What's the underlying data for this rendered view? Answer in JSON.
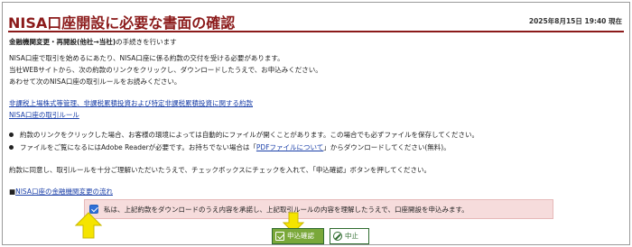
{
  "header": {
    "title": "NISA口座開設に必要な書面の確認",
    "datetime": "2025年8月15日 19:40 現在"
  },
  "intro": {
    "procedure_bold": "金融機関変更・再開設(他社→当社)",
    "procedure_rest": "の手続きを行います"
  },
  "body": {
    "para1": [
      "NISA口座で取引を始めるにあたり、NISA口座に係る約款の交付を受ける必要があります。",
      "当社WEBサイトから、次の約款のリンクをクリックし、ダウンロードしたうえで、お申込みください。",
      "あわせて次のNISA口座の取引ルールをお読みください。"
    ],
    "links": [
      "非課税上場株式等管理、非課税累積投資および特定非課税累積投資に関する約款",
      "NISA口座の取引ルール"
    ],
    "bullet1": "約款のリンクをクリックした場合、お客様の環境によっては自動的にファイルが開くことがあります。この場合でも必ずファイルを保存してください。",
    "bullet2_pre": "ファイルをご覧になるにはAdobe Readerが必要です。お持ちでない場合は「",
    "bullet2_link": "PDFファイルについて",
    "bullet2_post": "」からダウンロードしてください(無料)。",
    "instruction": "約款に同意し、取引ルールを十分ご理解いただいたうえで、チェックボックスにチェックを入れて、「申込確認」ボタンを押してください。",
    "transfer_prefix": "■",
    "transfer_link": "NISA口座の金融機関変更の流れ"
  },
  "agreement": {
    "checked": true,
    "text": "私は、上記約款をダウンロードのうえ内容を承諾し、上記取引ルールの内容を理解したうえで、口座開設を申込みます。"
  },
  "buttons": {
    "apply_label": "申込確認",
    "cancel_label": "中止"
  },
  "colors": {
    "title": "#8b1a1a",
    "link": "#1a3fa8",
    "agree_bg": "#f6dcdc",
    "apply_bg": "#7aa83a",
    "arrow": "#f5e400"
  }
}
